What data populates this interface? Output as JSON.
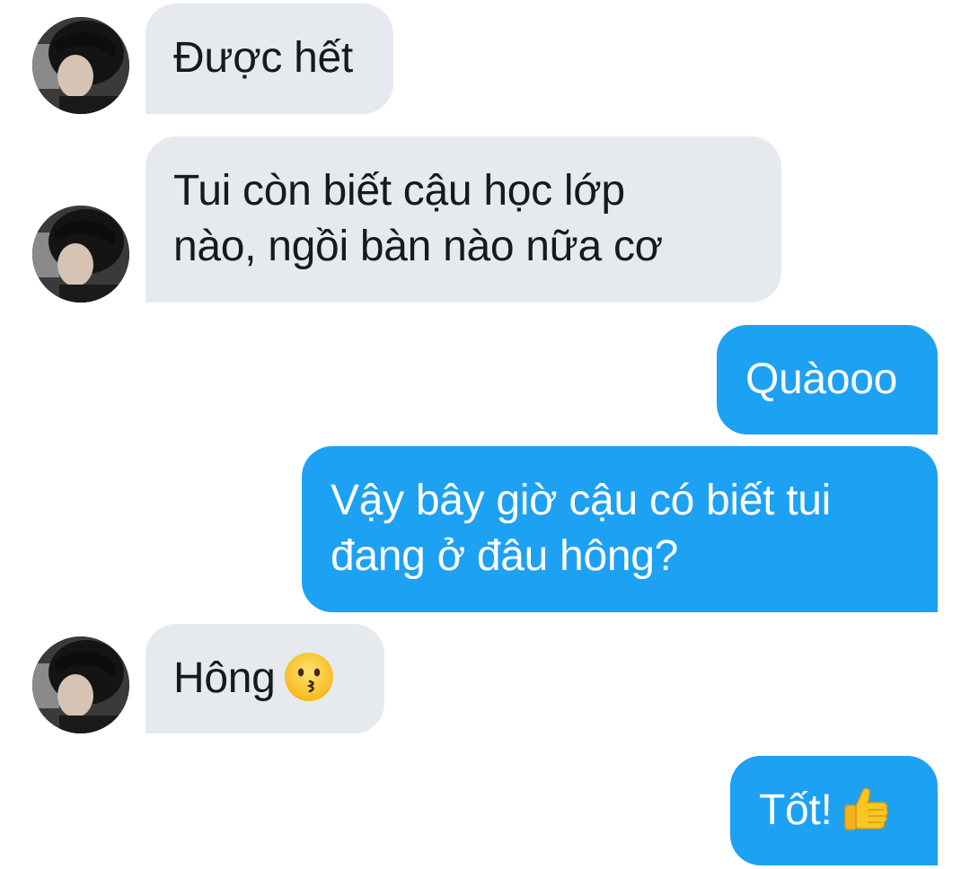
{
  "conversation": {
    "messages": [
      {
        "sender": "them",
        "text": "Được hết"
      },
      {
        "sender": "them",
        "text": "Tui còn biết cậu học lớp nào, ngồi bàn nào nữa cơ",
        "lines": [
          "Tui còn biết cậu học lớp",
          "nào, ngồi bàn nào nữa cơ"
        ]
      },
      {
        "sender": "me",
        "text": "Quàooo"
      },
      {
        "sender": "me",
        "text": "Vậy bây giờ cậu có biết tui đang ở đâu hông?",
        "lines": [
          "Vậy bây giờ cậu có biết tui",
          "đang ở đâu hông?"
        ]
      },
      {
        "sender": "them",
        "text": "Hông",
        "emoji": "kissing-face-icon"
      },
      {
        "sender": "me",
        "text": "Tốt!",
        "emoji": "thumbs-up-icon"
      }
    ]
  },
  "colors": {
    "incoming_bubble": "#e6eaee",
    "outgoing_bubble": "#1da1f2",
    "incoming_text": "#16191d",
    "outgoing_text": "#ffffff"
  }
}
